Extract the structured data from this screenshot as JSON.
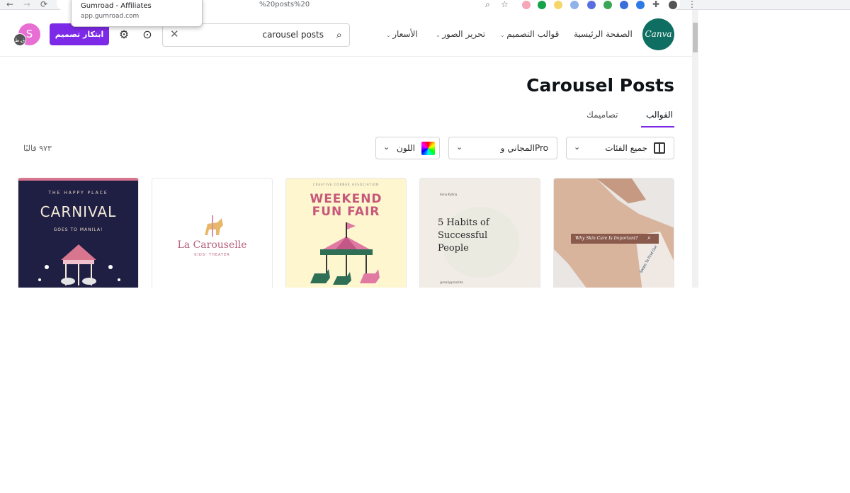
{
  "browser": {
    "url_fragment": "%20posts%20",
    "tooltip_title": "Gumroad - Affiliates",
    "tooltip_url": "app.gumroad.com"
  },
  "header": {
    "logo_text": "Canva",
    "nav": [
      "الصفحة الرئيسية",
      "قوالب التصميم",
      "تحرير الصور",
      "الأسعار"
    ],
    "search_value": "carousel posts",
    "create_label": "ابتكار تصميم",
    "avatar_letter": "S",
    "avatar_badge": "ق.ط"
  },
  "page": {
    "title": "Carousel Posts",
    "tabs": [
      "القوالب",
      "تصاميمك"
    ],
    "filters": {
      "categories": "جميع الفئات",
      "price": "المجاني وPro",
      "color": "اللون"
    },
    "count": "٩٧٣ قالبًا"
  },
  "cards": [
    {
      "line1": "THE HAPPY PLACE",
      "line2": "CARNIVAL",
      "line3": "GOES TO MANILA!"
    },
    {
      "line1": "La Carouselle",
      "line2": "KIDS' THEATER"
    },
    {
      "line0": "CREATIVE CORNER ASSOCIATION",
      "line1": "WEEKEND",
      "line2": "FUN FAIR"
    },
    {
      "line0": "Anna Katina",
      "line1": "5 Habits of",
      "line2": "Successful",
      "line3": "People",
      "line4": "@reallygreatsite"
    },
    {
      "line1": "Why Skin Care Is Important?",
      "line2": "Swipe To Find Out"
    }
  ],
  "colors": {
    "brand": "#0e6e61",
    "accent": "#7d2ae8"
  }
}
